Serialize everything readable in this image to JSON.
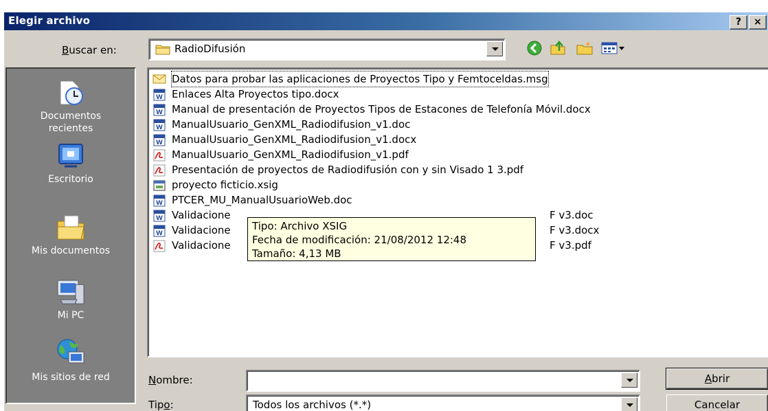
{
  "window": {
    "title": "Elegir archivo",
    "help_glyph": "?",
    "close_glyph": "×"
  },
  "lookin": {
    "label_ul": "B",
    "label_rest": "uscar en:",
    "value": "RadioDifusión"
  },
  "toolbar_icons": [
    "back-icon",
    "up-folder-icon",
    "new-folder-icon",
    "views-menu-icon"
  ],
  "places": [
    {
      "label_line1": "Documentos",
      "label_line2": "recientes",
      "icon": "recent-documents-icon"
    },
    {
      "label_line1": "Escritorio",
      "label_line2": "",
      "icon": "desktop-icon"
    },
    {
      "label_line1": "Mis documentos",
      "label_line2": "",
      "icon": "my-documents-icon"
    },
    {
      "label_line1": "Mi PC",
      "label_line2": "",
      "icon": "my-computer-icon"
    },
    {
      "label_line1": "Mis sitios de red",
      "label_line2": "",
      "icon": "network-places-icon"
    }
  ],
  "files": [
    {
      "name": "Datos para probar las aplicaciones de Proyectos Tipo y Femtoceldas.msg",
      "type": "msg"
    },
    {
      "name": "Enlaces Alta Proyectos tipo.docx",
      "type": "word"
    },
    {
      "name": "Manual de presentación de Proyectos Tipos de Estacones de Telefonía Móvil.docx",
      "type": "word"
    },
    {
      "name": "ManualUsuario_GenXML_Radiodifusion_v1.doc",
      "type": "word"
    },
    {
      "name": "ManualUsuario_GenXML_Radiodifusion_v1.docx",
      "type": "word"
    },
    {
      "name": "ManualUsuario_GenXML_Radiodifusion_v1.pdf",
      "type": "pdf"
    },
    {
      "name": "Presentación de proyectos de Radiodifusión con y sin Visado 1 3.pdf",
      "type": "pdf"
    },
    {
      "name": "proyecto ficticio.xsig",
      "type": "xsig"
    },
    {
      "name": "PTCER_MU_ManualUsuarioWeb.doc",
      "type": "word"
    },
    {
      "name": "Validacione",
      "tail": "F v3.doc",
      "type": "word"
    },
    {
      "name": "Validacione",
      "tail": "F v3.docx",
      "type": "word"
    },
    {
      "name": "Validacione",
      "tail": "F v3.pdf",
      "type": "pdf"
    }
  ],
  "tooltip": {
    "line1": "Tipo: Archivo XSIG",
    "line2": "Fecha de modificación: 21/08/2012 12:48",
    "line3": "Tamaño: 4,13 MB"
  },
  "name_field": {
    "label_ul": "N",
    "label_rest": "ombre:",
    "value": ""
  },
  "type_field": {
    "label_pre": "Tip",
    "label_ul": "o",
    "label_rest": ":",
    "value": "Todos los archivos (*.*)"
  },
  "buttons": {
    "open_ul": "A",
    "open_rest": "brir",
    "cancel": "Cancelar"
  }
}
